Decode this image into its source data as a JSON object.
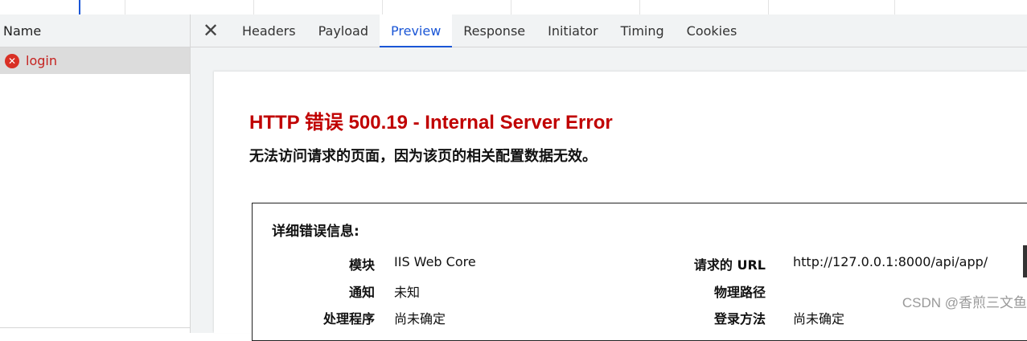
{
  "network_list": {
    "column_header": "Name",
    "requests": [
      {
        "name": "login",
        "status": "error"
      }
    ]
  },
  "tabs": {
    "close_symbol": "✕",
    "items": [
      "Headers",
      "Payload",
      "Preview",
      "Response",
      "Initiator",
      "Timing",
      "Cookies"
    ],
    "active": "Preview"
  },
  "preview": {
    "title": "HTTP 错误 500.19 - Internal Server Error",
    "subtitle": "无法访问请求的页面，因为该页的相关配置数据无效。",
    "details": {
      "heading": "详细错误信息:",
      "rows_left": [
        {
          "label": "模块",
          "value": "IIS Web Core"
        },
        {
          "label": "通知",
          "value": "未知"
        },
        {
          "label": "处理程序",
          "value": "尚未确定"
        }
      ],
      "rows_right": [
        {
          "label": "请求的 URL",
          "value": "http://127.0.0.1:8000/api/app/"
        },
        {
          "label": "物理路径",
          "value": ""
        },
        {
          "label": "登录方法",
          "value": "尚未确定"
        }
      ]
    }
  },
  "watermark": "CSDN @香煎三文鱼",
  "colors": {
    "error_red": "#c00000",
    "active_tab_blue": "#1a56d6",
    "error_icon": "#d93025"
  }
}
